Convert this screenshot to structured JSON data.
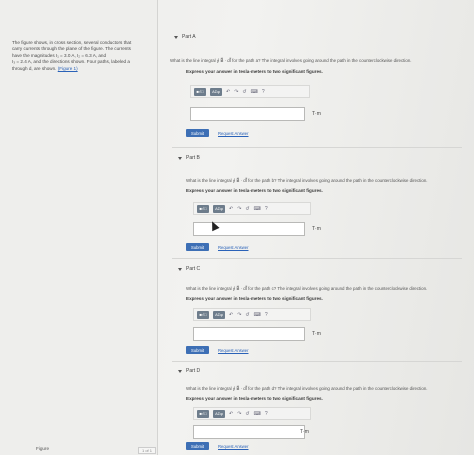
{
  "problem": {
    "text_lines": [
      "The figure shows, in cross section, several conductors that",
      "carry currents through the plane of the figure. The currents",
      "have the magnitudes I₁ = 3.0 A, I₂ = 6.3 A, and",
      "I₃ = 2.4 A, and the directions shown. Four paths, labeled a",
      "through d, are shown."
    ],
    "figure_link": "(Figure 1)"
  },
  "figure": {
    "label": "Figure",
    "pager": "1 of 1"
  },
  "toolbar": {
    "template_btn": "■√□",
    "greek_btn": "AΣφ",
    "undo": "↶",
    "redo": "↷",
    "reset": "↺",
    "keyboard": "⌨",
    "help": "?"
  },
  "parts": [
    {
      "title": "Part A",
      "question": "What is the line integral ∮ B⃗ · dl⃗ for the path a? The integral involves going around the path in the counterclockwise direction.",
      "instruction": "Express your answer in tesla-meters to two significant figures.",
      "answer": "",
      "unit": "T·m",
      "submit": "Submit",
      "request": "Request Answer"
    },
    {
      "title": "Part B",
      "question": "What is the line integral ∮ B⃗ · dl⃗ for the path b? The integral involves going around the path in the counterclockwise direction.",
      "instruction": "Express your answer in tesla-meters to two significant figures.",
      "answer": "",
      "unit": "T·m",
      "submit": "Submit",
      "request": "Request Answer"
    },
    {
      "title": "Part C",
      "question": "What is the line integral ∮ B⃗ · dl⃗ for the path c? The integral involves going around the path in the counterclockwise direction.",
      "instruction": "Express your answer in tesla-meters to two significant figures.",
      "answer": "",
      "unit": "T·m",
      "submit": "Submit",
      "request": "Request Answer"
    },
    {
      "title": "Part D",
      "question": "What is the line integral ∮ B⃗ · dl⃗ for the path d? The integral involves going around the path in the counterclockwise direction.",
      "instruction": "Express your answer in tesla-meters to two significant figures.",
      "answer": "",
      "unit": "T·m",
      "submit": "Submit",
      "request": "Request Answer"
    }
  ],
  "colors": {
    "submit": "#3d6fb5",
    "link": "#2a62b8",
    "toolbar_btn": "#6e7d8c"
  }
}
